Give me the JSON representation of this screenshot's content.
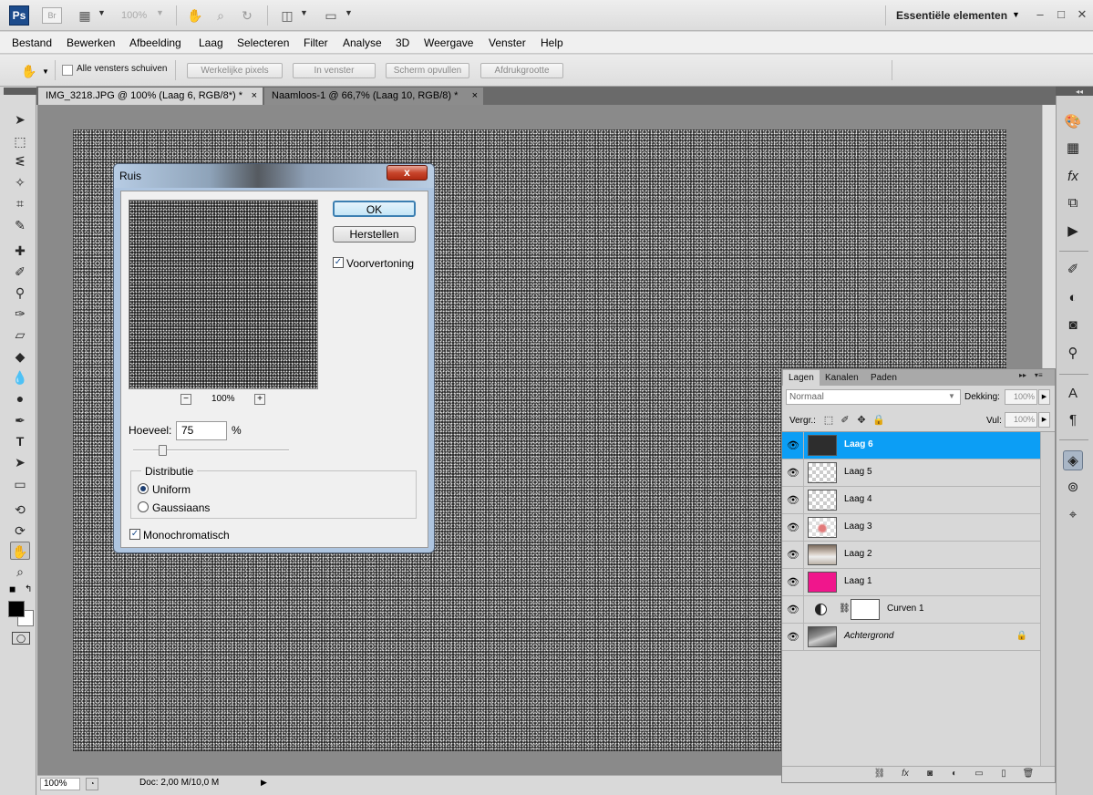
{
  "app": {
    "logo": "Ps",
    "bridge": "Br",
    "zoom": "100%",
    "workspace": "Essentiële elementen",
    "window_controls": [
      "–",
      "□",
      "✕"
    ]
  },
  "menu": [
    "Bestand",
    "Bewerken",
    "Afbeelding",
    "Laag",
    "Selecteren",
    "Filter",
    "Analyse",
    "3D",
    "Weergave",
    "Venster",
    "Help"
  ],
  "options": {
    "all_windows_label": "Alle vensters schuiven",
    "buttons": [
      "Werkelijke pixels",
      "In venster",
      "Scherm opvullen",
      "Afdrukgrootte"
    ]
  },
  "tabs": [
    {
      "label": "IMG_3218.JPG @ 100% (Laag 6, RGB/8*) *",
      "close": "×"
    },
    {
      "label": "Naamloos-1 @ 66,7% (Laag 10, RGB/8) *",
      "close": "×"
    }
  ],
  "status": {
    "zoom": "100%",
    "doc": "Doc: 2,00 M/10,0 M"
  },
  "dialog": {
    "title": "Ruis",
    "close": "x",
    "ok": "OK",
    "reset": "Herstellen",
    "preview_label": "Voorvertoning",
    "preview_checked": true,
    "zoom_minus": "−",
    "zoom_plus": "+",
    "preview_zoom": "100%",
    "amount_label": "Hoeveel:",
    "amount": "75",
    "amount_unit": "%",
    "distribution_label": "Distributie",
    "uniform_label": "Uniform",
    "gaussian_label": "Gaussiaans",
    "selected_distribution": "Uniform",
    "mono_label": "Monochromatisch",
    "mono_checked": true
  },
  "layers_panel": {
    "tabs": [
      "Lagen",
      "Kanalen",
      "Paden"
    ],
    "blend_mode": "Normaal",
    "opacity_label": "Dekking:",
    "opacity": "100%",
    "lock_label": "Vergr.:",
    "fill_label": "Vul:",
    "fill": "100%",
    "layers": [
      {
        "name": "Laag 6",
        "selected": true
      },
      {
        "name": "Laag 5"
      },
      {
        "name": "Laag 4"
      },
      {
        "name": "Laag 3"
      },
      {
        "name": "Laag 2"
      },
      {
        "name": "Laag 1"
      },
      {
        "name": "Curven 1"
      },
      {
        "name": "Achtergrond",
        "locked": true
      }
    ]
  },
  "colors": {
    "accent": "#0c9ef5",
    "layer1_fill": "#f0168c"
  }
}
